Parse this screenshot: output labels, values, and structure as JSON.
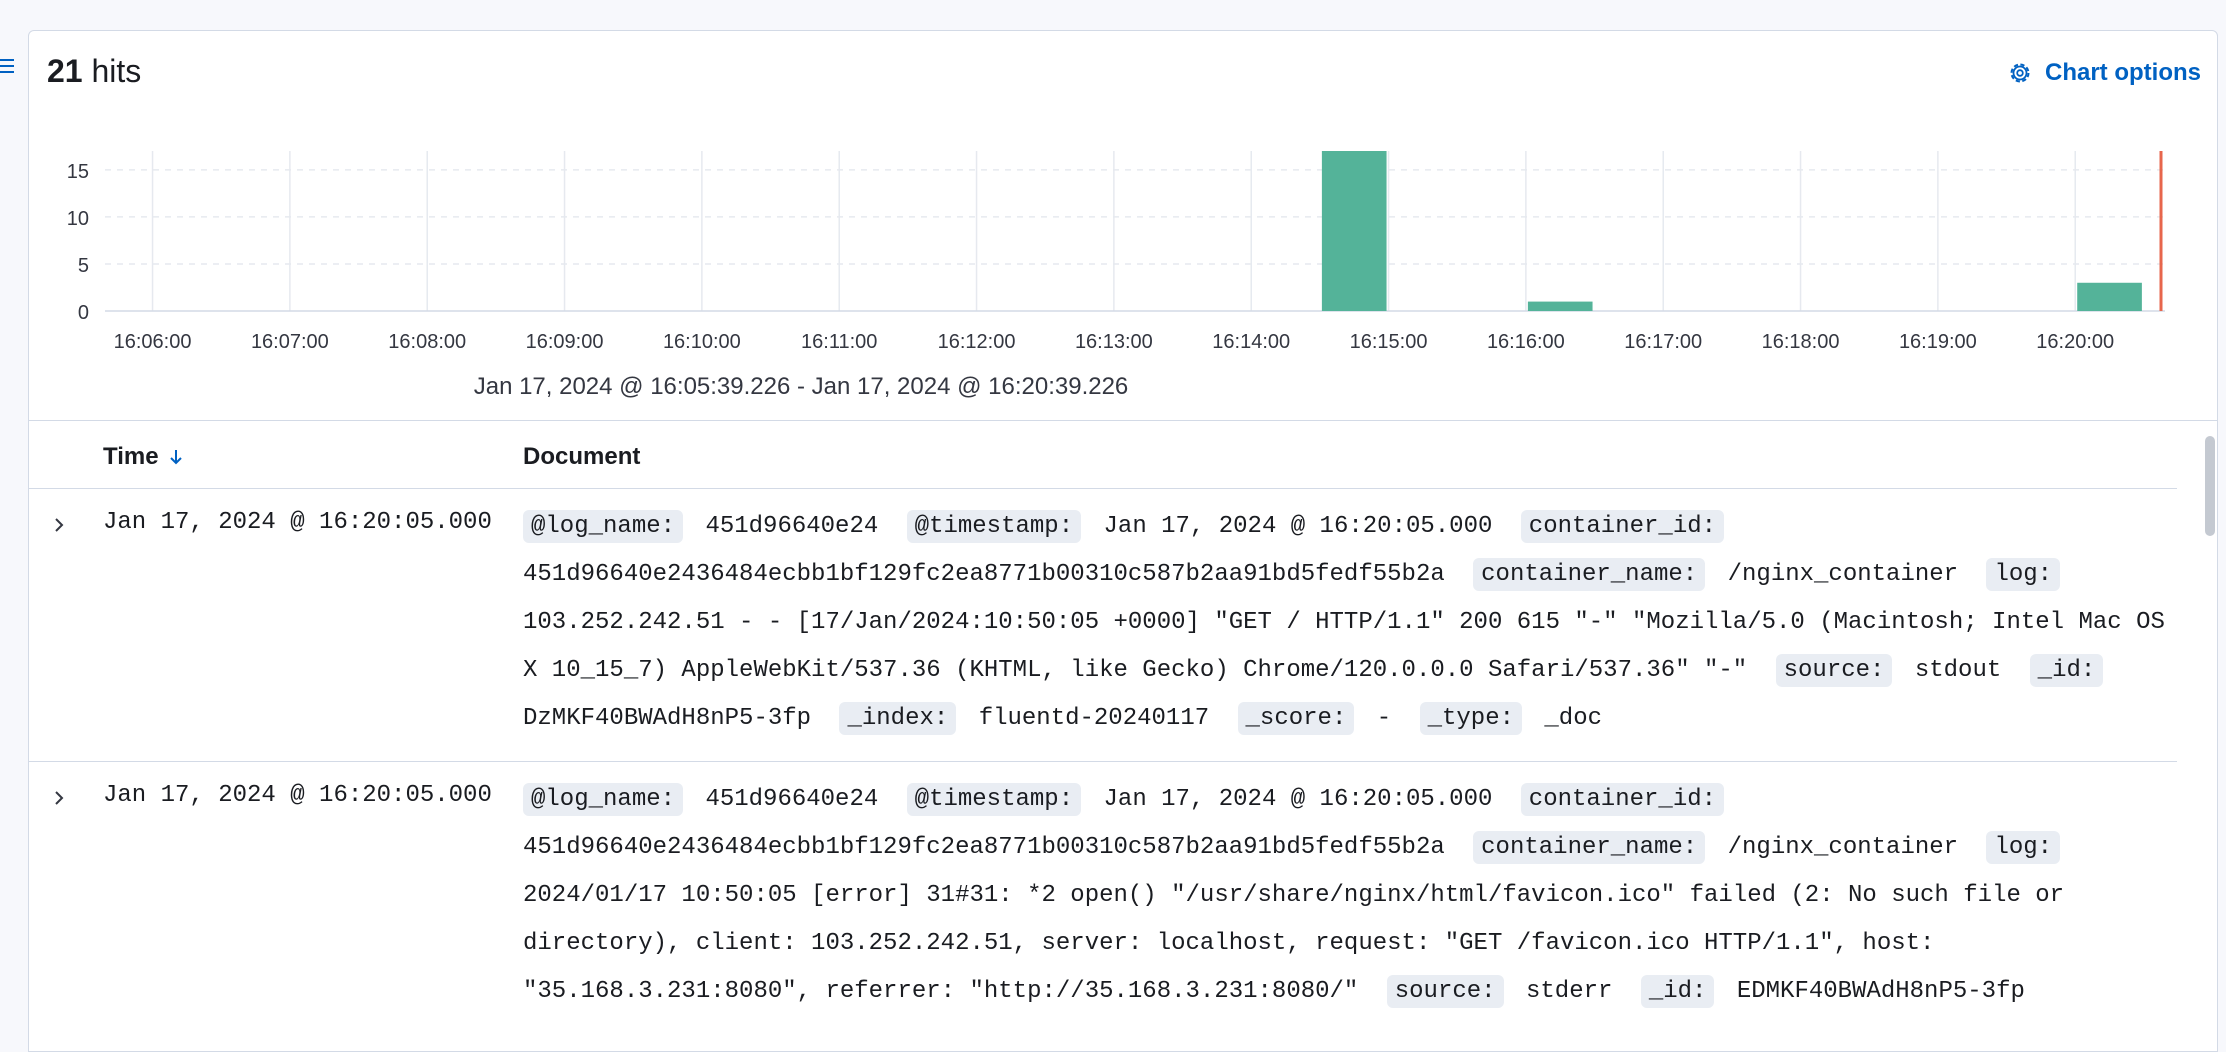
{
  "header": {
    "hits_count": "21",
    "hits_label": "hits",
    "chart_options_label": "Chart options"
  },
  "chart_data": {
    "type": "bar",
    "x_tick_labels": [
      "16:06:00",
      "16:07:00",
      "16:08:00",
      "16:09:00",
      "16:10:00",
      "16:11:00",
      "16:12:00",
      "16:13:00",
      "16:14:00",
      "16:15:00",
      "16:16:00",
      "16:17:00",
      "16:18:00",
      "16:19:00",
      "16:20:00"
    ],
    "y_tick_labels": [
      "0",
      "5",
      "10",
      "15"
    ],
    "ylim": [
      0,
      17
    ],
    "xlim": [
      "16:05:39.226",
      "16:20:39.226"
    ],
    "interval_seconds": 30,
    "bars": [
      {
        "start": "16:14:30",
        "value": 17
      },
      {
        "start": "16:16:00",
        "value": 1
      },
      {
        "start": "16:20:00",
        "value": 3
      }
    ],
    "bar_color": "#54b399",
    "now_marker_color": "#e7664c",
    "grid": true,
    "time_range": "Jan 17, 2024 @ 16:05:39.226 - Jan 17, 2024 @ 16:20:39.226"
  },
  "table": {
    "columns": {
      "time": "Time",
      "document": "Document"
    },
    "rows": [
      {
        "time": "Jan 17, 2024 @ 16:20:05.000",
        "fields": [
          {
            "key": "@log_name:",
            "value": "451d96640e24"
          },
          {
            "key": "@timestamp:",
            "value": "Jan 17, 2024 @ 16:20:05.000"
          },
          {
            "key": "container_id:",
            "value": "451d96640e2436484ecbb1bf129fc2ea8771b00310c587b2aa91bd5fedf55b2a"
          },
          {
            "key": "container_name:",
            "value": "/nginx_container"
          },
          {
            "key": "log:",
            "value": "103.252.242.51 - - [17/Jan/2024:10:50:05 +0000] \"GET / HTTP/1.1\" 200 615 \"-\" \"Mozilla/5.0 (Macintosh; Intel Mac OS X 10_15_7) AppleWebKit/537.36 (KHTML, like Gecko) Chrome/120.0.0.0 Safari/537.36\" \"-\""
          },
          {
            "key": "source:",
            "value": "stdout"
          },
          {
            "key": "_id:",
            "value": "DzMKF40BWAdH8nP5-3fp"
          },
          {
            "key": "_index:",
            "value": "fluentd-20240117"
          },
          {
            "key": "_score:",
            "value": " - "
          },
          {
            "key": "_type:",
            "value": "_doc"
          }
        ]
      },
      {
        "time": "Jan 17, 2024 @ 16:20:05.000",
        "fields": [
          {
            "key": "@log_name:",
            "value": "451d96640e24"
          },
          {
            "key": "@timestamp:",
            "value": "Jan 17, 2024 @ 16:20:05.000"
          },
          {
            "key": "container_id:",
            "value": "451d96640e2436484ecbb1bf129fc2ea8771b00310c587b2aa91bd5fedf55b2a"
          },
          {
            "key": "container_name:",
            "value": "/nginx_container"
          },
          {
            "key": "log:",
            "value": "2024/01/17 10:50:05 [error] 31#31: *2 open() \"/usr/share/nginx/html/favicon.ico\" failed (2: No such file or directory), client: 103.252.242.51, server: localhost, request: \"GET /favicon.ico HTTP/1.1\", host: \"35.168.3.231:8080\", referrer: \"http://35.168.3.231:8080/\""
          },
          {
            "key": "source:",
            "value": "stderr"
          },
          {
            "key": "_id:",
            "value": "EDMKF40BWAdH8nP5-3fp"
          }
        ]
      }
    ]
  }
}
